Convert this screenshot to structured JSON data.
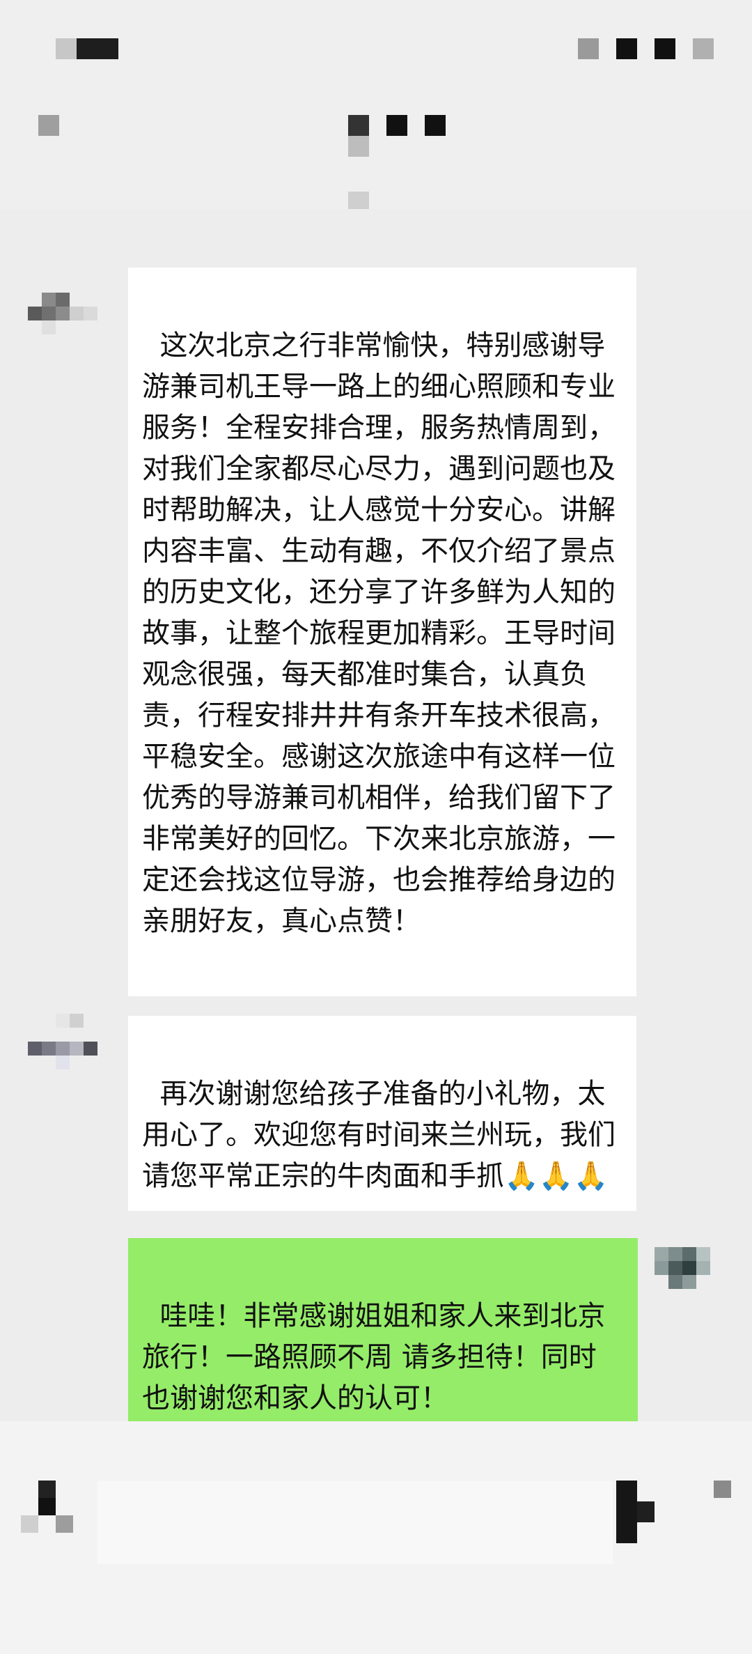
{
  "messages": [
    {
      "id": "m1",
      "direction": "incoming",
      "text": "这次北京之行非常愉快，特别感谢导游兼司机王导一路上的细心照顾和专业服务！全程安排合理，服务热情周到，对我们全家都尽心尽力，遇到问题也及时帮助解决，让人感觉十分安心。讲解内容丰富、生动有趣，不仅介绍了景点的历史文化，还分享了许多鲜为人知的故事，让整个旅程更加精彩。王导时间观念很强，每天都准时集合，认真负责，行程安排井井有条开车技术很高，平稳安全。感谢这次旅途中有这样一位优秀的导游兼司机相伴，给我们留下了非常美好的回忆。下次来北京旅游，一定还会找这位导游，也会推荐给身边的亲朋好友，真心点赞！"
    },
    {
      "id": "m2",
      "direction": "incoming",
      "text": "再次谢谢您给孩子准备的小礼物，太用心了。欢迎您有时间来兰州玩，我们请您平常正宗的牛肉面和手抓🙏🙏🙏"
    },
    {
      "id": "m3",
      "direction": "outgoing",
      "text": "哇哇！非常感谢姐姐和家人来到北京旅行！一路照顾不周 请多担待！同时也谢谢您和家人的认可！\n🎉🎉🎉北京欢迎您🎉🎉🎉"
    }
  ],
  "colors": {
    "background": "#ededed",
    "incoming_bubble": "#ffffff",
    "outgoing_bubble": "#95ec69",
    "text": "#111111"
  },
  "icons": [
    "back-icon",
    "more-icon",
    "voice-icon",
    "emoji-icon",
    "add-icon"
  ]
}
